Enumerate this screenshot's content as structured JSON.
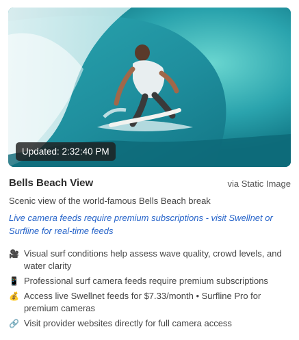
{
  "media": {
    "updated_label": "Updated: 2:32:40 PM"
  },
  "title": "Bells Beach View",
  "source_label": "via Static Image",
  "description": "Scenic view of the world-famous Bells Beach break",
  "notice": "Live camera feeds require premium subscriptions - visit Swellnet or Surfline for real-time feeds",
  "features": [
    {
      "icon": "camera-icon",
      "glyph": "🎥",
      "text": "Visual surf conditions help assess wave quality, crowd levels, and water clarity"
    },
    {
      "icon": "phone-icon",
      "glyph": "📱",
      "text": "Professional surf camera feeds require premium subscriptions"
    },
    {
      "icon": "money-bag-icon",
      "glyph": "💰",
      "text": "Access live Swellnet feeds for $7.33/month • Surfline Pro for premium cameras"
    },
    {
      "icon": "link-icon",
      "glyph": "🔗",
      "text": "Visit provider websites directly for full camera access"
    }
  ]
}
